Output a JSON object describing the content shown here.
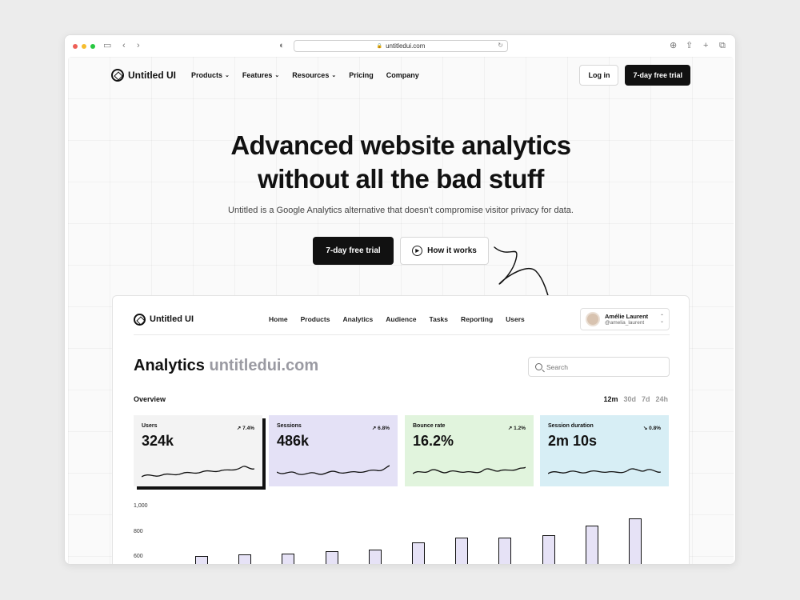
{
  "browser": {
    "url": "untitledui.com",
    "dots": [
      "#ee5f57",
      "#f6bd2e",
      "#27c840"
    ]
  },
  "site": {
    "logo_text": "Untitled UI",
    "nav": [
      {
        "label": "Products",
        "has_dropdown": true
      },
      {
        "label": "Features",
        "has_dropdown": true
      },
      {
        "label": "Resources",
        "has_dropdown": true
      },
      {
        "label": "Pricing",
        "has_dropdown": false
      },
      {
        "label": "Company",
        "has_dropdown": false
      }
    ],
    "login_label": "Log in",
    "trial_label": "7-day free trial"
  },
  "hero": {
    "title_line1": "Advanced website analytics",
    "title_line2": "without all the bad stuff",
    "subtitle": "Untitled is a Google Analytics alternative that doesn't compromise visitor privacy for data.",
    "primary_cta": "7-day free trial",
    "secondary_cta": "How it works"
  },
  "dashboard": {
    "logo_text": "Untitled UI",
    "nav": [
      "Home",
      "Products",
      "Analytics",
      "Audience",
      "Tasks",
      "Reporting",
      "Users"
    ],
    "user": {
      "name": "Amélie Laurent",
      "handle": "@amelia_laurent"
    },
    "title": "Analytics",
    "domain": "untitledui.com",
    "search_placeholder": "Search",
    "overview_label": "Overview",
    "ranges": [
      "12m",
      "30d",
      "7d",
      "24h"
    ],
    "active_range": "12m",
    "cards": [
      {
        "label": "Users",
        "value": "324k",
        "change": "7.4%",
        "trend": "up",
        "color": "#f3f3f3"
      },
      {
        "label": "Sessions",
        "value": "486k",
        "change": "6.8%",
        "trend": "up",
        "color": "#e4e1f6"
      },
      {
        "label": "Bounce rate",
        "value": "16.2%",
        "change": "1.2%",
        "trend": "up",
        "color": "#e1f4dd"
      },
      {
        "label": "Session duration",
        "value": "2m 10s",
        "change": "0.8%",
        "trend": "down",
        "color": "#d7eef5"
      }
    ]
  },
  "chart_data": {
    "type": "bar",
    "y_ticks": [
      "1,000",
      "800",
      "600"
    ],
    "values": [
      610,
      625,
      630,
      650,
      665,
      720,
      760,
      760,
      775,
      855,
      910
    ],
    "ylim": [
      0,
      1000
    ]
  }
}
